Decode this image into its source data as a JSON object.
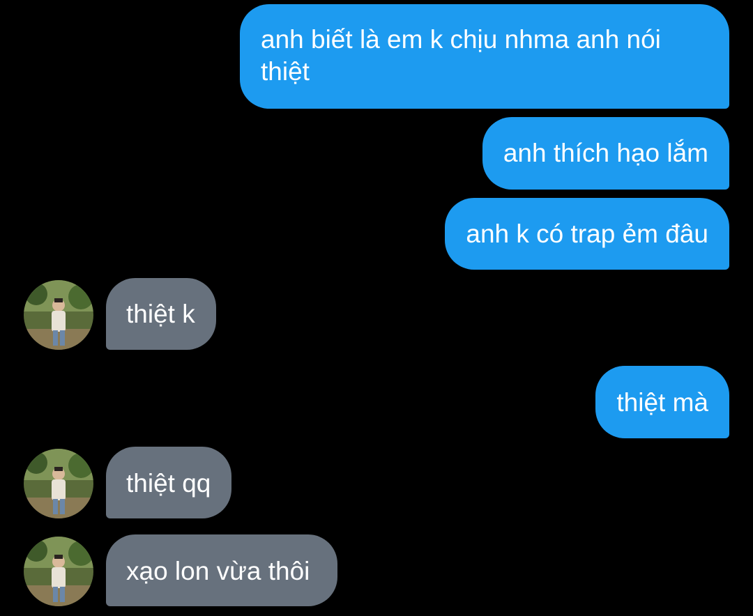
{
  "colors": {
    "background": "#000000",
    "outgoing_bubble": "#1d9bf0",
    "incoming_bubble": "#67717d",
    "text": "#ffffff"
  },
  "messages": [
    {
      "direction": "outgoing",
      "text": "anh biết là em k chịu nhma anh nói thiệt"
    },
    {
      "direction": "outgoing",
      "text": "anh thích hạo lắm"
    },
    {
      "direction": "outgoing",
      "text": "anh k có trap ẻm đâu"
    },
    {
      "direction": "incoming",
      "text": "thiệt k",
      "avatar_icon": "user-photo-avatar"
    },
    {
      "direction": "outgoing",
      "text": "thiệt mà"
    },
    {
      "direction": "incoming",
      "text": "thiệt qq",
      "avatar_icon": "user-photo-avatar"
    },
    {
      "direction": "incoming",
      "text": "xạo lon vừa thôi",
      "avatar_icon": "user-photo-avatar"
    }
  ]
}
